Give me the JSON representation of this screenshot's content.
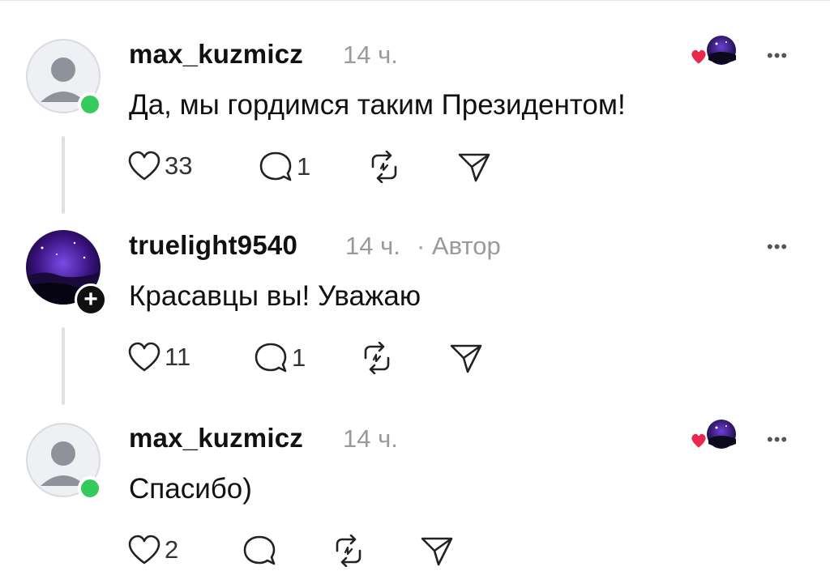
{
  "comments": [
    {
      "username": "max_kuzmicz",
      "time": "14 ч.",
      "text": "Да, мы гордимся таким Президентом!",
      "likes": "33",
      "replies": "1",
      "online": true
    },
    {
      "username": "truelight9540",
      "time": "14 ч.",
      "author_tag": "· Автор",
      "text": "Красавцы вы! Уважаю",
      "likes": "11",
      "replies": "1"
    },
    {
      "username": "max_kuzmicz",
      "time": "14 ч.",
      "text": "Спасибо)",
      "likes": "2",
      "replies": "",
      "online": true
    }
  ],
  "more_label": "•••",
  "follow_label": "+",
  "colors": {
    "online": "#36c95c",
    "heart": "#e8294b",
    "night_sky": "#4a1c8c"
  },
  "icons": [
    "heart-icon",
    "comment-icon",
    "repost-icon",
    "share-icon",
    "more-icon",
    "liked-by-author-icon"
  ]
}
